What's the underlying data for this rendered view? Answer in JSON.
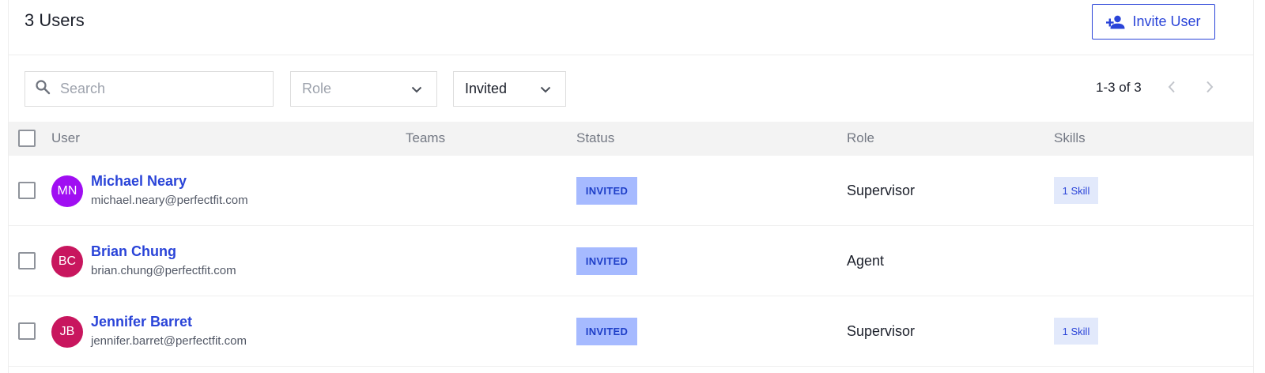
{
  "header": {
    "title": "3 Users",
    "invite_button_label": "Invite User",
    "invite_icon": "add-person-icon"
  },
  "toolbar": {
    "search_placeholder": "Search",
    "search_value": "",
    "role_filter": {
      "placeholder": "Role",
      "value": ""
    },
    "status_filter": {
      "value": "Invited"
    },
    "pagination": "1-3 of 3"
  },
  "table": {
    "columns": [
      "User",
      "Teams",
      "Status",
      "Role",
      "Skills"
    ],
    "rows": [
      {
        "initials": "MN",
        "avatar_color": "#a00ef2",
        "name": "Michael Neary",
        "email": "michael.neary@perfectfit.com",
        "teams": "",
        "status": "INVITED",
        "role": "Supervisor",
        "skills": "1 Skill"
      },
      {
        "initials": "BC",
        "avatar_color": "#c8165e",
        "name": "Brian Chung",
        "email": "brian.chung@perfectfit.com",
        "teams": "",
        "status": "INVITED",
        "role": "Agent",
        "skills": ""
      },
      {
        "initials": "JB",
        "avatar_color": "#c8165e",
        "name": "Jennifer Barret",
        "email": "jennifer.barret@perfectfit.com",
        "teams": "",
        "status": "INVITED",
        "role": "Supervisor",
        "skills": "1 Skill"
      }
    ]
  },
  "colors": {
    "accent": "#2a44d8",
    "status_badge_bg": "#a6baff",
    "skill_badge_bg": "#e2e9fb",
    "header_row_bg": "#f3f3f3"
  }
}
